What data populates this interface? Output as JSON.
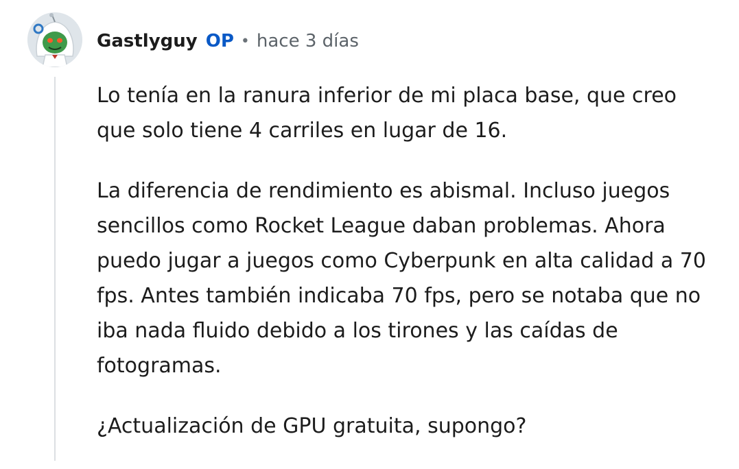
{
  "comment": {
    "author": "Gastlyguy",
    "op_badge": "OP",
    "separator": "•",
    "timestamp": "hace 3 días",
    "avatar_icon": "snoo-avatar-icon",
    "paragraphs": [
      "Lo tenía en la ranura inferior de mi placa base, que creo que solo tiene 4 carriles en lugar de 16.",
      "La diferencia de rendimiento es abismal. Incluso juegos sencillos como Rocket League daban problemas. Ahora puedo jugar a juegos como Cyberpunk en alta calidad a 70 fps. Antes también indicaba 70 fps, pero se notaba que no iba nada fluido debido a los tirones y las caídas de fotogramas.",
      "¿Actualización de GPU gratuita, supongo?"
    ]
  },
  "colors": {
    "op_badge": "#0a59c6",
    "text": "#1c1c1c",
    "meta": "#5c6369",
    "thread_line": "#dcdfe2"
  }
}
